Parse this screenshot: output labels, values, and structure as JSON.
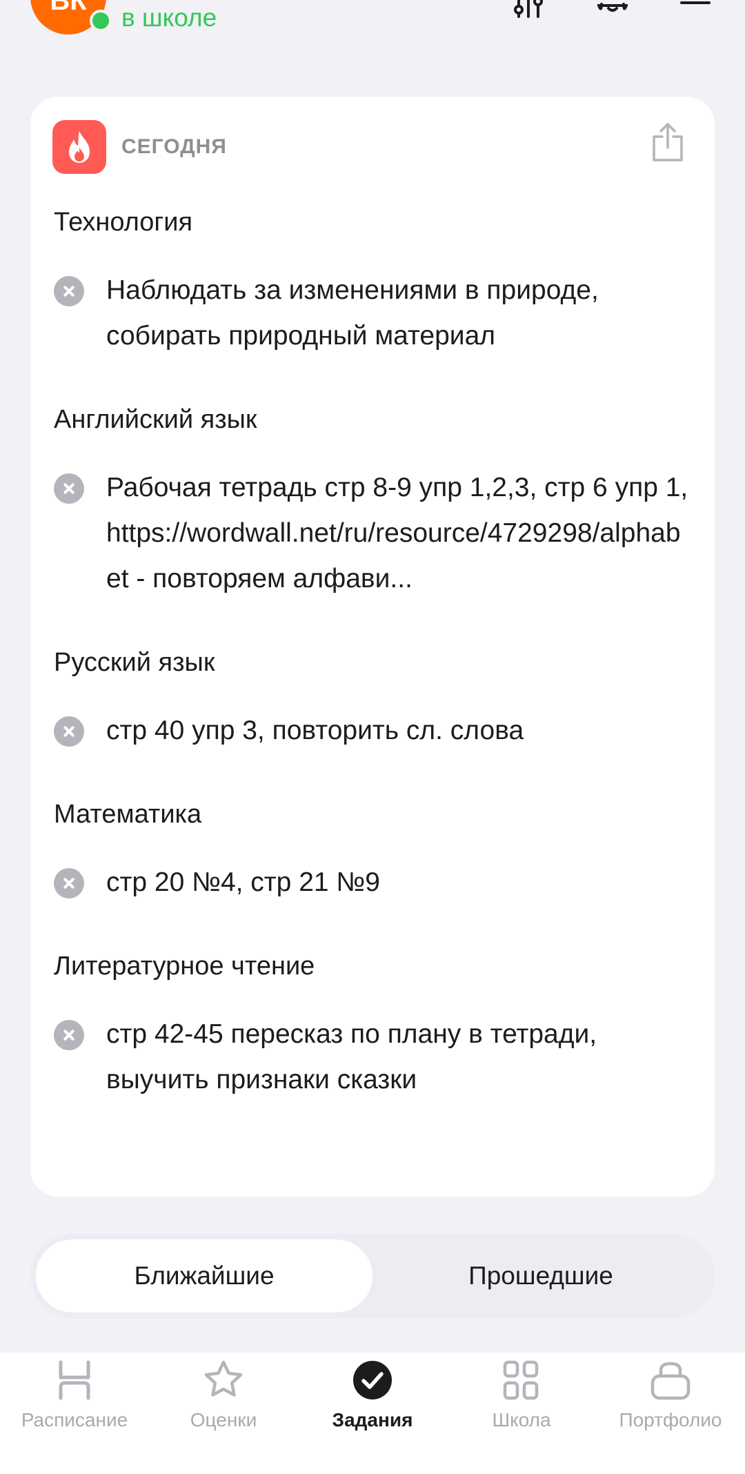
{
  "header": {
    "avatar_initials": "ВК",
    "status": "в школе",
    "icons": [
      "filter-icon",
      "bell-icon",
      "menu-icon"
    ]
  },
  "card": {
    "section_label": "СЕГОДНЯ",
    "badge_icon": "fire-icon",
    "share_icon": "share-icon",
    "tasks": [
      {
        "subject": "Технология",
        "text": "Наблюдать за изменениями в природе,\nсобирать природный материал"
      },
      {
        "subject": "Английский язык",
        "text": "Рабочая тетрадь стр 8-9 упр 1,2,3,  стр 6 упр 1, https://wordwall.net/ru/resource/4729298/alphabet - повторяем алфави..."
      },
      {
        "subject": "Русский язык",
        "text": "стр 40 упр 3, повторить сл. слова"
      },
      {
        "subject": "Математика",
        "text": "стр 20 №4, стр 21 №9"
      },
      {
        "subject": "Литературное чтение",
        "text": "стр 42-45 пересказ по плану в тетради,\nвыучить признаки сказки"
      }
    ]
  },
  "segment": {
    "active": "Ближайшие",
    "inactive": "Прошедшие"
  },
  "nav": {
    "items": [
      {
        "label": "Расписание",
        "icon": "schedule-icon"
      },
      {
        "label": "Оценки",
        "icon": "star-icon"
      },
      {
        "label": "Задания",
        "icon": "check-circle-icon",
        "active": true
      },
      {
        "label": "Школа",
        "icon": "grid-icon"
      },
      {
        "label": "Портфолио",
        "icon": "briefcase-icon"
      }
    ]
  },
  "colors": {
    "background": "#f1f1f6",
    "accent_green": "#34c759",
    "avatar_orange": "#ff6b00",
    "badge_red": "#ff5a54",
    "muted_gray": "#8e8e93"
  }
}
